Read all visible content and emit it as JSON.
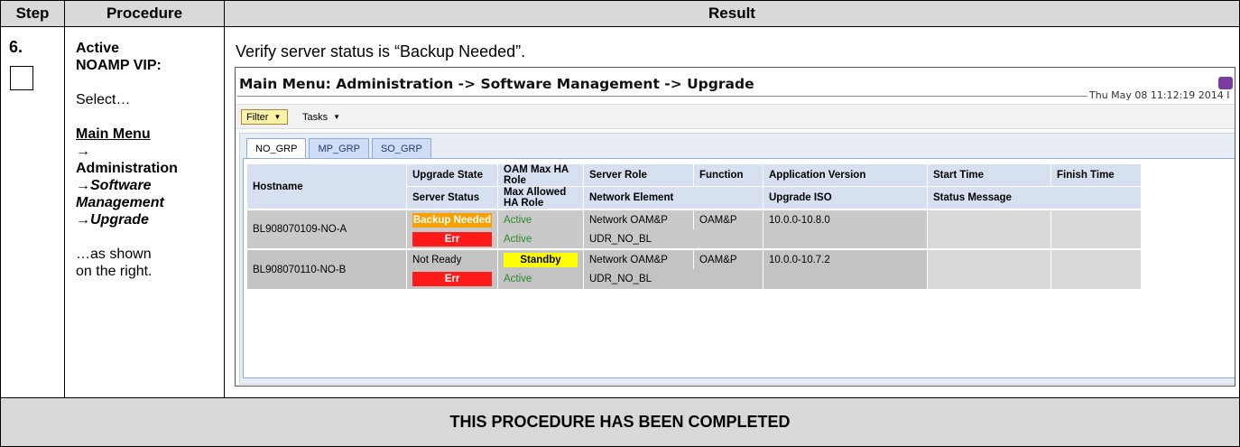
{
  "header": {
    "step": "Step",
    "procedure": "Procedure",
    "result": "Result"
  },
  "step": {
    "number": "6."
  },
  "procedure": {
    "line1": "Active",
    "line2": "NOAMP VIP:",
    "line3": "Select…",
    "line4": "Main Menu",
    "line5": "→",
    "line6": "Administration",
    "line7": "→Software",
    "line8": "Management",
    "line9": "→Upgrade",
    "line10": "…as shown",
    "line11": "on the right."
  },
  "result": {
    "instruction": "Verify server status is “Backup Needed”."
  },
  "screen": {
    "title": "Main Menu: Administration -> Software Management -> Upgrade",
    "help_glyph": "H",
    "timestamp": "Thu May 08 11:12:19 2014 I",
    "toolbar": {
      "filter": "Filter",
      "tasks": "Tasks",
      "caret": "▼"
    },
    "tabs": [
      "NO_GRP",
      "MP_GRP",
      "SO_GRP"
    ],
    "columns": {
      "hostname": "Hostname",
      "upgrade_state": "Upgrade State",
      "server_status": "Server Status",
      "oam_max_ha_role": "OAM Max HA Role",
      "max_allowed_ha_role": "Max Allowed HA Role",
      "server_role": "Server Role",
      "network_element": "Network Element",
      "function": "Function",
      "application_version": "Application Version",
      "upgrade_iso": "Upgrade ISO",
      "start_time": "Start Time",
      "status_message": "Status Message",
      "finish_time": "Finish Time"
    },
    "rows": [
      {
        "hostname": "BL908070109-NO-A",
        "upgrade_state": "Backup Needed",
        "server_status": "Err",
        "oam_max_ha_role": "Active",
        "max_allowed_ha_role": "Active",
        "server_role": "Network OAM&P",
        "network_element": "UDR_NO_BL",
        "function": "OAM&P",
        "application_version": "10.0.0-10.8.0"
      },
      {
        "hostname": "BL908070110-NO-B",
        "upgrade_state": "Not Ready",
        "server_status": "Err",
        "oam_max_ha_role": "Standby",
        "max_allowed_ha_role": "Active",
        "server_role": "Network OAM&P",
        "network_element": "UDR_NO_BL",
        "function": "OAM&P",
        "application_version": "10.0.0-10.7.2"
      }
    ],
    "colors": {
      "backup_needed": "#f7a000",
      "err": "#ff1a1a",
      "standby": "#ffff00",
      "active_text": "#2a8a2a"
    }
  },
  "footer": {
    "text": "THIS PROCEDURE HAS BEEN COMPLETED"
  }
}
